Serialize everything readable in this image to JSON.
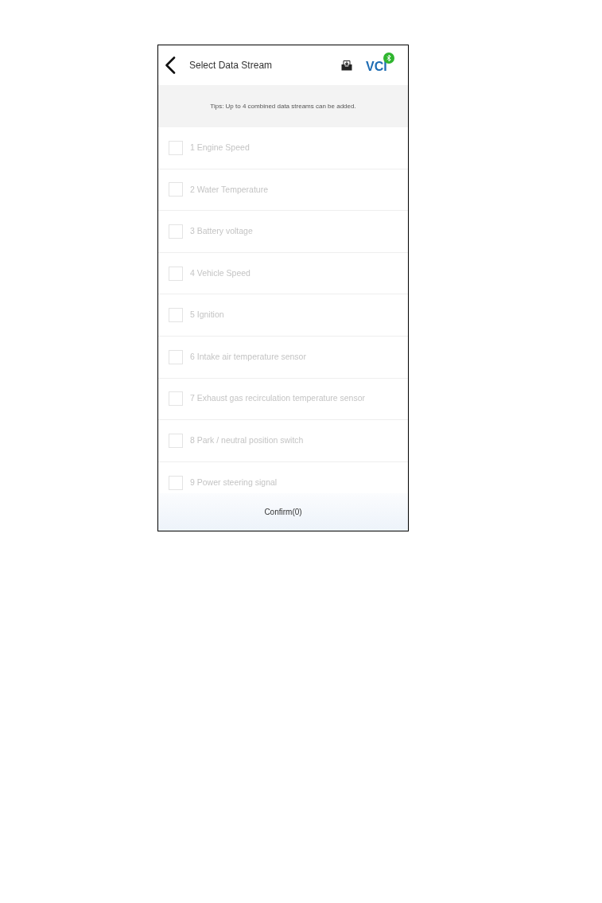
{
  "header": {
    "title": "Select Data Stream",
    "logo": "VCI"
  },
  "tips": "Tips: Up to 4 combined data streams can be added.",
  "streams": [
    {
      "label": "1 Engine Speed",
      "checked": false
    },
    {
      "label": "2 Water Temperature",
      "checked": false
    },
    {
      "label": "3 Battery voltage",
      "checked": false
    },
    {
      "label": "4 Vehicle Speed",
      "checked": false
    },
    {
      "label": "5 Ignition",
      "checked": false
    },
    {
      "label": "6 Intake air temperature sensor",
      "checked": false
    },
    {
      "label": "7 Exhaust gas recirculation temperature sensor",
      "checked": false
    },
    {
      "label": "8 Park / neutral position switch",
      "checked": false
    },
    {
      "label": "9 Power steering signal",
      "checked": false
    }
  ],
  "confirm_button": "Confirm(0)"
}
